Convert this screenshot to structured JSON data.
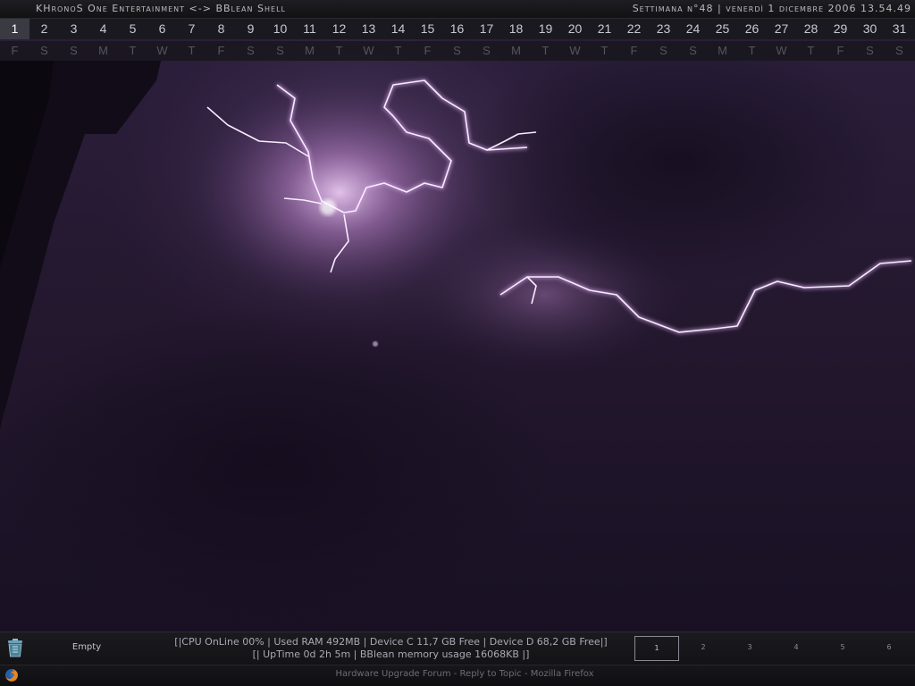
{
  "topbar": {
    "title": "KHronoS One Entertainment <-> BBlean Shell",
    "clock": "Settimana n°48 | venerdì 1 dicembre 2006 13.54.49"
  },
  "calendar": {
    "days": [
      "1",
      "2",
      "3",
      "4",
      "5",
      "6",
      "7",
      "8",
      "9",
      "10",
      "11",
      "12",
      "13",
      "14",
      "15",
      "16",
      "17",
      "18",
      "19",
      "20",
      "21",
      "22",
      "23",
      "24",
      "25",
      "26",
      "27",
      "28",
      "29",
      "30",
      "31"
    ],
    "weekdays": [
      "F",
      "S",
      "S",
      "M",
      "T",
      "W",
      "T",
      "F",
      "S",
      "S",
      "M",
      "T",
      "W",
      "T",
      "F",
      "S",
      "S",
      "M",
      "T",
      "W",
      "T",
      "F",
      "S",
      "S",
      "M",
      "T",
      "W",
      "T",
      "F",
      "S",
      "S"
    ],
    "today": "1"
  },
  "bottom": {
    "recycle_icon": "recycle-bin-icon",
    "recycle_label": "Empty",
    "sysinfo_line1": "[|CPU OnLine 00% | Used RAM 492MB | Device C 11,7 GB Free | Device D 68,2 GB Free|]",
    "sysinfo_line2": "[| UpTime 0d 2h 5m | BBlean memory usage 16068KB |]",
    "workspaces": [
      "1",
      "2",
      "3",
      "4",
      "5",
      "6"
    ],
    "active_workspace": "1"
  },
  "taskbar": {
    "app_icon": "firefox-icon",
    "title": "Hardware Upgrade Forum - Reply to Topic - Mozilla Firefox"
  },
  "colors": {
    "sky": "#2a1d3c",
    "lightning": "#f4e4ff",
    "glow": "#b07ab8"
  }
}
